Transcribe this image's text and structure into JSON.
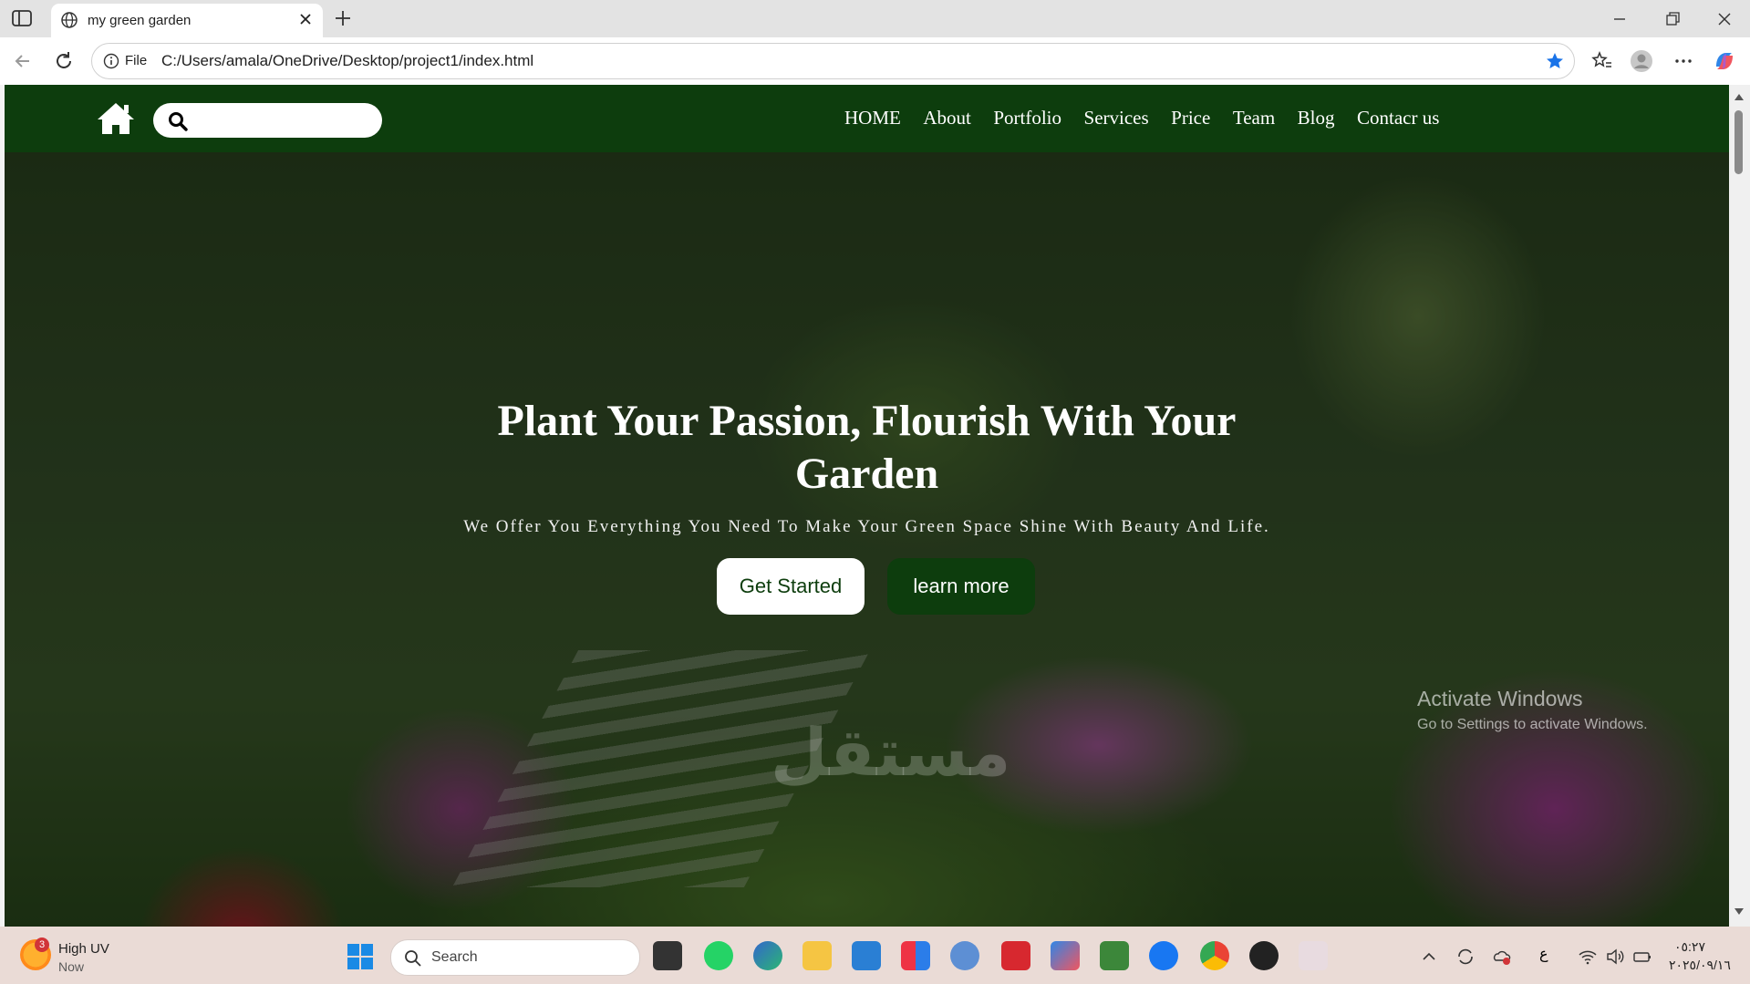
{
  "browser": {
    "tab_title": "my green garden",
    "address_prefix": "File",
    "url": "C:/Users/amala/OneDrive/Desktop/project1/index.html"
  },
  "site": {
    "nav_links": [
      "HOME",
      "About",
      "Portfolio",
      "Services",
      "Price",
      "Team",
      "Blog",
      "Contacr us"
    ],
    "search_placeholder": "",
    "hero_title_line1": "Plant Your Passion, Flourish With Your",
    "hero_title_line2": "Garden",
    "hero_subtitle": "We Offer You Everything You Need To Make Your Green Space Shine With Beauty And Life.",
    "btn_primary": "Get Started",
    "btn_secondary": "learn more",
    "brand_color": "#0d3d0d"
  },
  "overlay": {
    "activate_title": "Activate Windows",
    "activate_sub": "Go to Settings to activate Windows.",
    "watermark": "مستقل"
  },
  "taskbar": {
    "weather_badge": "3",
    "weather_label": "High UV",
    "weather_time": "Now",
    "search_placeholder": "Search",
    "lang": "ع",
    "clock_time": "٠٥:٢٧",
    "clock_date": "٢٠٢٥/٠٩/١٦"
  }
}
